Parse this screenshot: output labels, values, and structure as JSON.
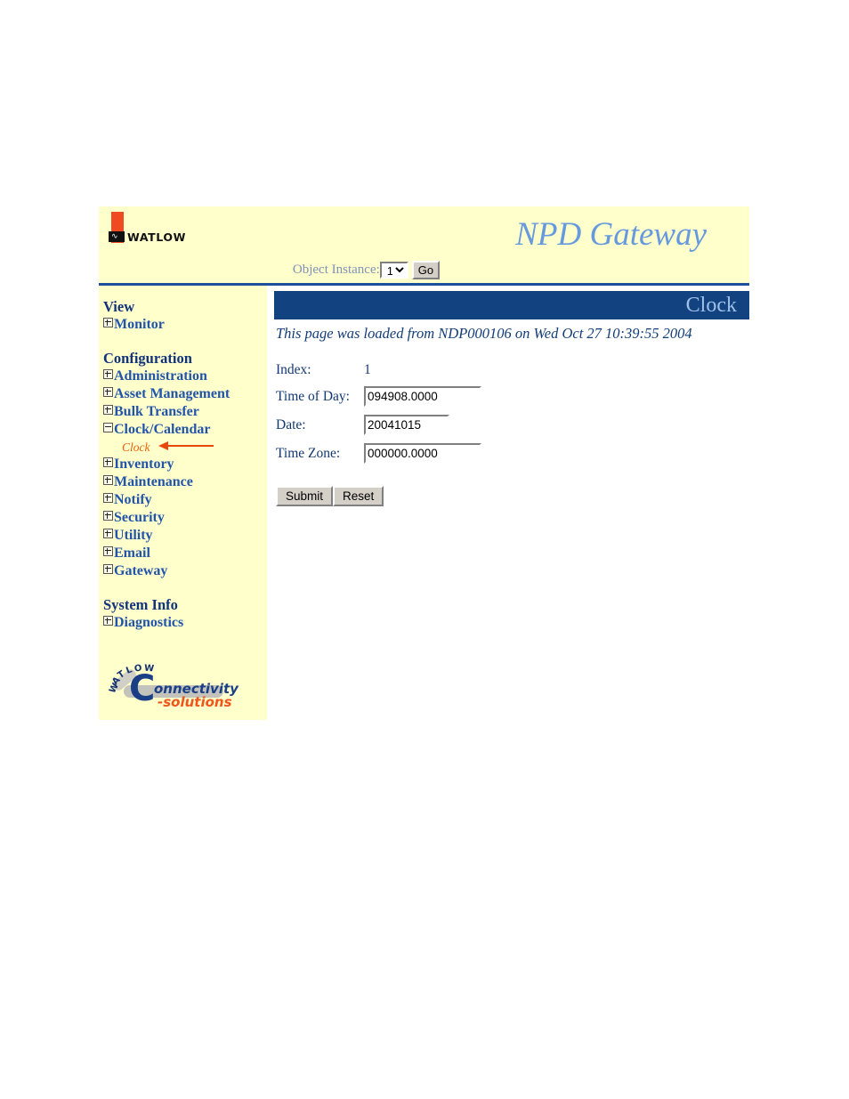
{
  "header": {
    "brand_text": "WATLOW",
    "brand_mark_icon": "watlow-logo-icon",
    "site_title": "NPD Gateway",
    "object_instance_label": "Object Instance:",
    "object_instance_value": "1",
    "object_instance_options": [
      "1"
    ],
    "go_label": "Go"
  },
  "sidebar": {
    "sections": [
      {
        "heading": "View",
        "items": [
          {
            "label": "Monitor",
            "state": "collapsed"
          }
        ]
      },
      {
        "heading": "Configuration",
        "items": [
          {
            "label": "Administration",
            "state": "collapsed"
          },
          {
            "label": "Asset Management",
            "state": "collapsed"
          },
          {
            "label": "Bulk Transfer",
            "state": "collapsed"
          },
          {
            "label": "Clock/Calendar",
            "state": "expanded",
            "children": [
              {
                "label": "Clock",
                "selected": true,
                "annotated": true
              }
            ]
          },
          {
            "label": "Inventory",
            "state": "collapsed"
          },
          {
            "label": "Maintenance",
            "state": "collapsed"
          },
          {
            "label": "Notify",
            "state": "collapsed"
          },
          {
            "label": "Security",
            "state": "collapsed"
          },
          {
            "label": "Utility",
            "state": "collapsed"
          },
          {
            "label": "Email",
            "state": "collapsed"
          },
          {
            "label": "Gateway",
            "state": "collapsed"
          }
        ]
      },
      {
        "heading": "System Info",
        "items": [
          {
            "label": "Diagnostics",
            "state": "collapsed"
          }
        ]
      }
    ],
    "logo": {
      "watlow_arc": "WATLOW",
      "c_letter": "C",
      "onnectivity": "onnectivity",
      "solutions": "-solutions"
    }
  },
  "content": {
    "title": "Clock",
    "loaded_message": "This page was loaded from NDP000106 on Wed Oct 27 10:39:55 2004",
    "fields": [
      {
        "label": "Index:",
        "value": "1",
        "type": "text"
      },
      {
        "label": "Time of Day:",
        "value": "094908.0000",
        "type": "input",
        "size": "long"
      },
      {
        "label": "Date:",
        "value": "20041015",
        "type": "input",
        "size": "short"
      },
      {
        "label": "Time Zone:",
        "value": "000000.0000",
        "type": "input",
        "size": "long"
      }
    ],
    "submit_label": "Submit",
    "reset_label": "Reset"
  },
  "colors": {
    "header_bg": "#ffffcc",
    "banner_bg": "#124380",
    "banner_text": "#9fc0e8",
    "link_blue": "#2255aa",
    "heading_blue": "#11337a",
    "accent_orange": "#e8470c",
    "title_blue": "#6699dd"
  }
}
